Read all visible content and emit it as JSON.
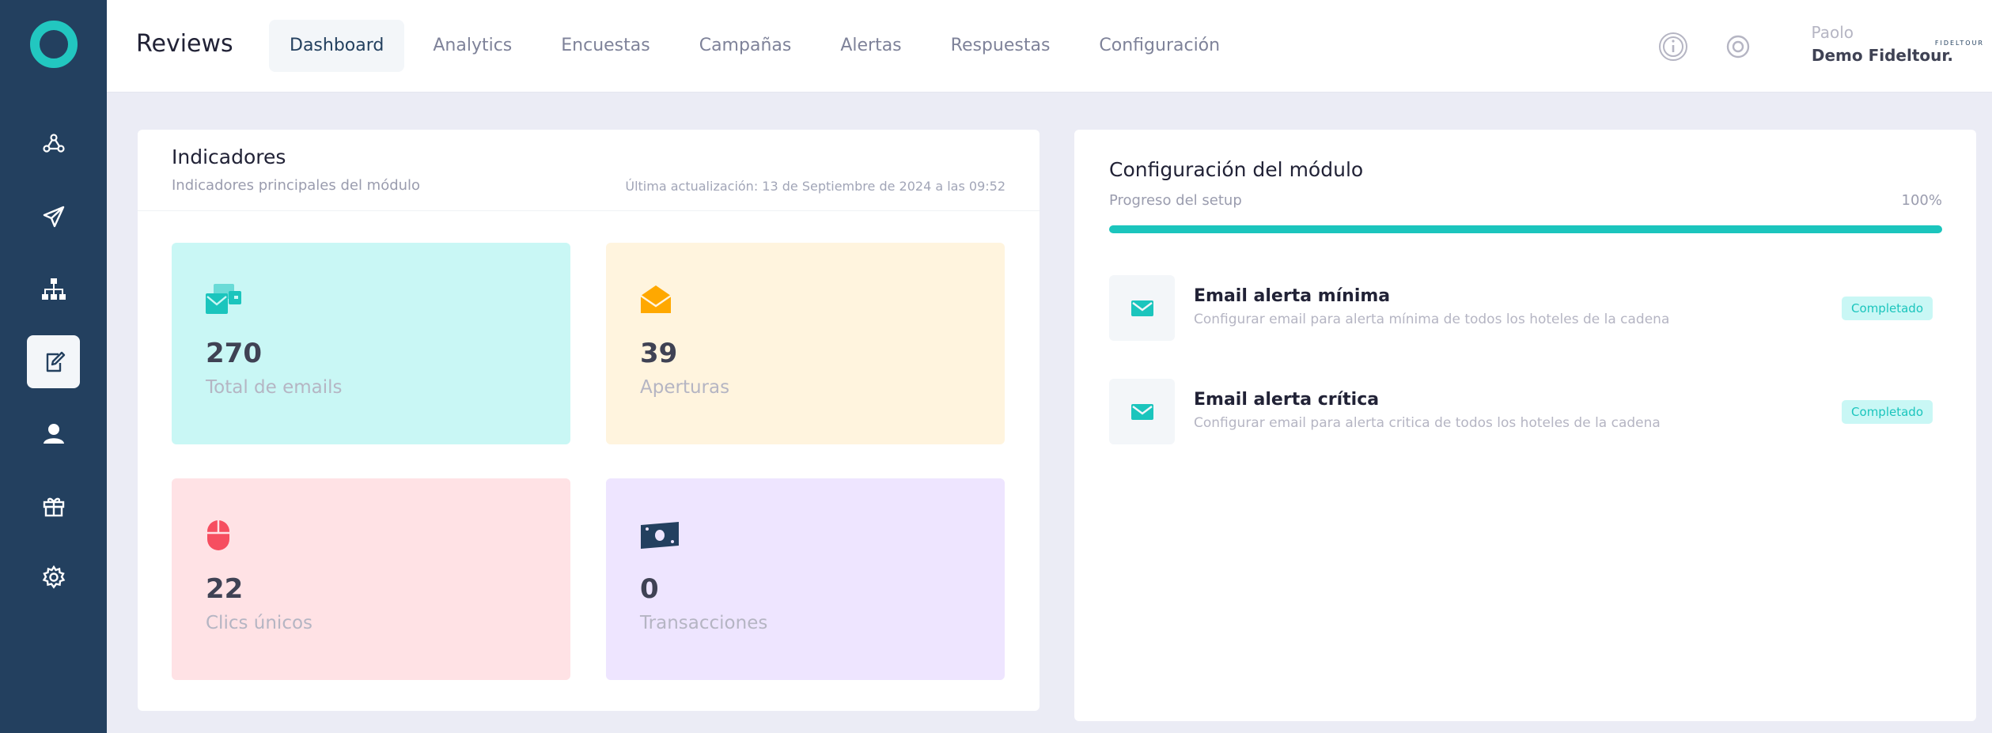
{
  "app": {
    "title": "Reviews"
  },
  "nav": {
    "tabs": [
      {
        "label": "Dashboard",
        "active": true
      },
      {
        "label": "Analytics",
        "active": false
      },
      {
        "label": "Encuestas",
        "active": false
      },
      {
        "label": "Campañas",
        "active": false
      },
      {
        "label": "Alertas",
        "active": false
      },
      {
        "label": "Respuestas",
        "active": false
      },
      {
        "label": "Configuración",
        "active": false
      }
    ]
  },
  "sidebar": {
    "items": [
      {
        "icon": "network-people-icon",
        "active": false
      },
      {
        "icon": "paper-plane-icon",
        "active": false
      },
      {
        "icon": "sitemap-icon",
        "active": false
      },
      {
        "icon": "edit-note-icon",
        "active": true
      },
      {
        "icon": "user-icon",
        "active": false
      },
      {
        "icon": "gift-icon",
        "active": false
      },
      {
        "icon": "gear-icon",
        "active": false
      }
    ]
  },
  "user": {
    "first_name": "Paolo",
    "company": "Demo Fideltour.",
    "logo_text": "FIDELTOUR"
  },
  "indicators": {
    "title": "Indicadores",
    "subtitle": "Indicadores principales del módulo",
    "updated": "Última actualización: 13 de Septiembre de 2024 a las 09:52",
    "tiles": [
      {
        "value": "270",
        "label": "Total de emails",
        "icon": "emails-icon",
        "bg": "#c9f7f5",
        "icon_color": "#1bc5bd"
      },
      {
        "value": "39",
        "label": "Aperturas",
        "icon": "open-envelope-icon",
        "bg": "#fff4de",
        "icon_color": "#ffa800"
      },
      {
        "value": "22",
        "label": "Clics únicos",
        "icon": "mouse-icon",
        "bg": "#ffe2e5",
        "icon_color": "#f64e60"
      },
      {
        "value": "0",
        "label": "Transacciones",
        "icon": "money-icon",
        "bg": "#eee5ff",
        "icon_color": "#23405f"
      }
    ]
  },
  "module_config": {
    "title": "Configuración del módulo",
    "progress_label": "Progreso del setup",
    "progress_value": "100%",
    "progress_fraction": 1.0,
    "tasks": [
      {
        "title": "Email alerta mínima",
        "description": "Configurar email para alerta mínima de todos los hoteles de la cadena",
        "status": "Completado",
        "icon": "envelope-icon"
      },
      {
        "title": "Email alerta crítica",
        "description": "Configurar email para alerta critica de todos los hoteles de la cadena",
        "status": "Completado",
        "icon": "envelope-icon"
      }
    ]
  },
  "colors": {
    "sidebar": "#23405f",
    "accent": "#1bc5bd",
    "background": "#ebecf5"
  }
}
